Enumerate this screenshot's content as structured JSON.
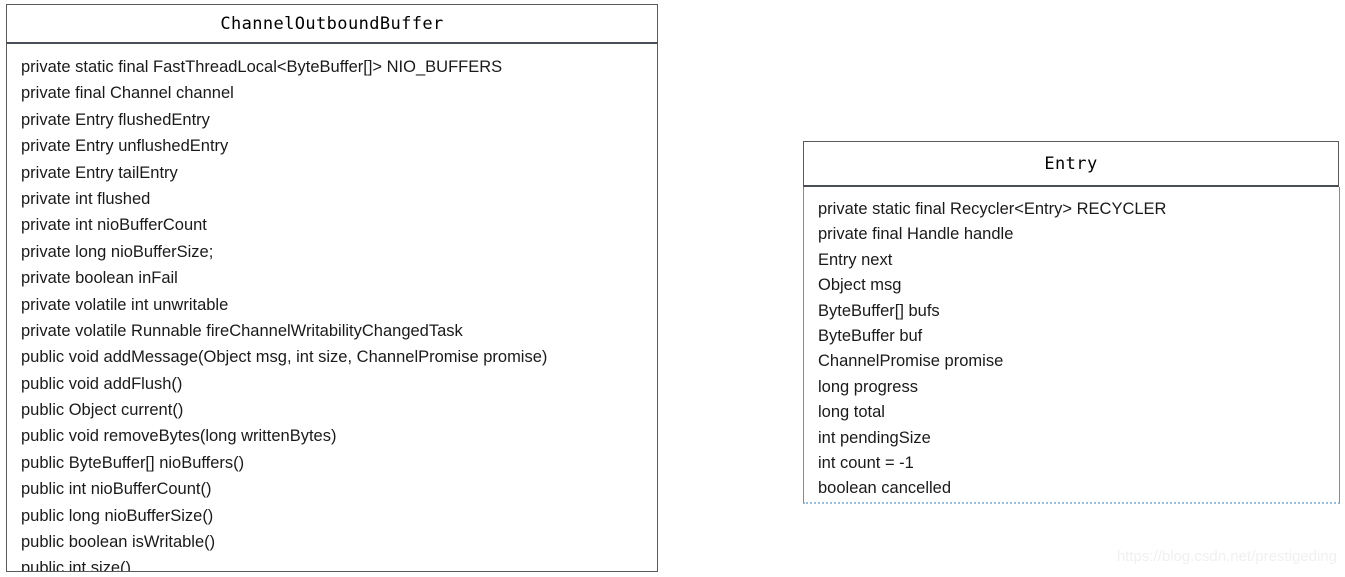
{
  "diagram": {
    "type": "uml-class-diagram",
    "background_color": "#ffffff",
    "border_color": "#5a5a5a",
    "text_color": "#1a1a1a",
    "entry_dotted_border_color": "#9dbcd6"
  },
  "classes": [
    {
      "id": "channel-outbound-buffer",
      "title": "ChannelOutboundBuffer",
      "members": [
        "private static final FastThreadLocal<ByteBuffer[]> NIO_BUFFERS",
        "private final Channel channel",
        "private Entry flushedEntry",
        "private Entry unflushedEntry",
        "private Entry tailEntry",
        "private int flushed",
        "private int nioBufferCount",
        "private long nioBufferSize;",
        "private boolean inFail",
        "private volatile int unwritable",
        "private volatile Runnable fireChannelWritabilityChangedTask",
        "public void addMessage(Object msg, int size, ChannelPromise promise)",
        "public void addFlush()",
        "public Object current()",
        "public void removeBytes(long writtenBytes)",
        "public ByteBuffer[] nioBuffers()",
        "public int nioBufferCount()",
        "public long nioBufferSize()",
        "public boolean isWritable()",
        "public int size()"
      ]
    },
    {
      "id": "entry",
      "title": "Entry",
      "members": [
        "private static final Recycler<Entry> RECYCLER",
        "private final Handle handle",
        "Entry next",
        "Object msg",
        "ByteBuffer[] bufs",
        "ByteBuffer buf",
        "ChannelPromise promise",
        "long progress",
        "long total",
        "int pendingSize",
        "int count = -1",
        "boolean cancelled"
      ]
    }
  ],
  "watermark": {
    "text": "https://blog.csdn.net/prestigeding"
  }
}
